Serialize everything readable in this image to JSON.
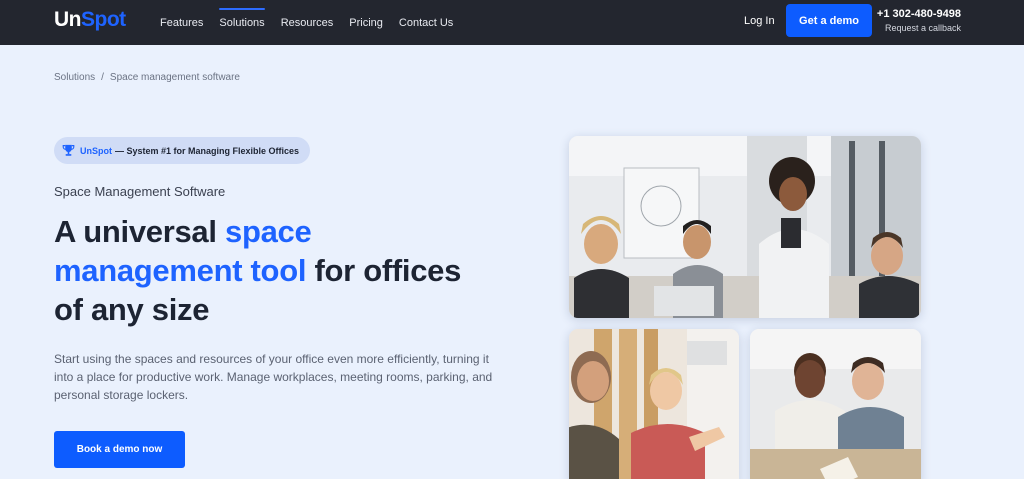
{
  "header": {
    "logo": {
      "part1": "Un",
      "part2": "Spot"
    },
    "nav": [
      "Features",
      "Solutions",
      "Resources",
      "Pricing",
      "Contact Us"
    ],
    "active_nav": "Solutions",
    "login_label": "Log In",
    "demo_label": "Get a demo",
    "phone": "+1 302-480-9498",
    "callback_label": "Request a callback"
  },
  "breadcrumb": {
    "root": "Solutions",
    "separator": "/",
    "current": "Space management software"
  },
  "hero": {
    "badge": {
      "icon": "trophy-icon",
      "brand": "UnSpot",
      "text": "— System #1 for Managing Flexible Offices"
    },
    "subtitle": "Space Management Software",
    "headline": {
      "part1": "A universal ",
      "highlight": "space management tool",
      "part2": " for offices of any size"
    },
    "description": "Start using the spaces and resources of your office even more efficiently, turning it into a place for productive work. Manage workplaces, meeting rooms, parking, and personal storage lockers.",
    "cta_label": "Book a demo now"
  },
  "colors": {
    "header_bg": "#23262f",
    "page_bg": "#eaf1fd",
    "accent": "#1e63ff",
    "button": "#0d5cff",
    "badge_bg": "#d0dcf6"
  }
}
